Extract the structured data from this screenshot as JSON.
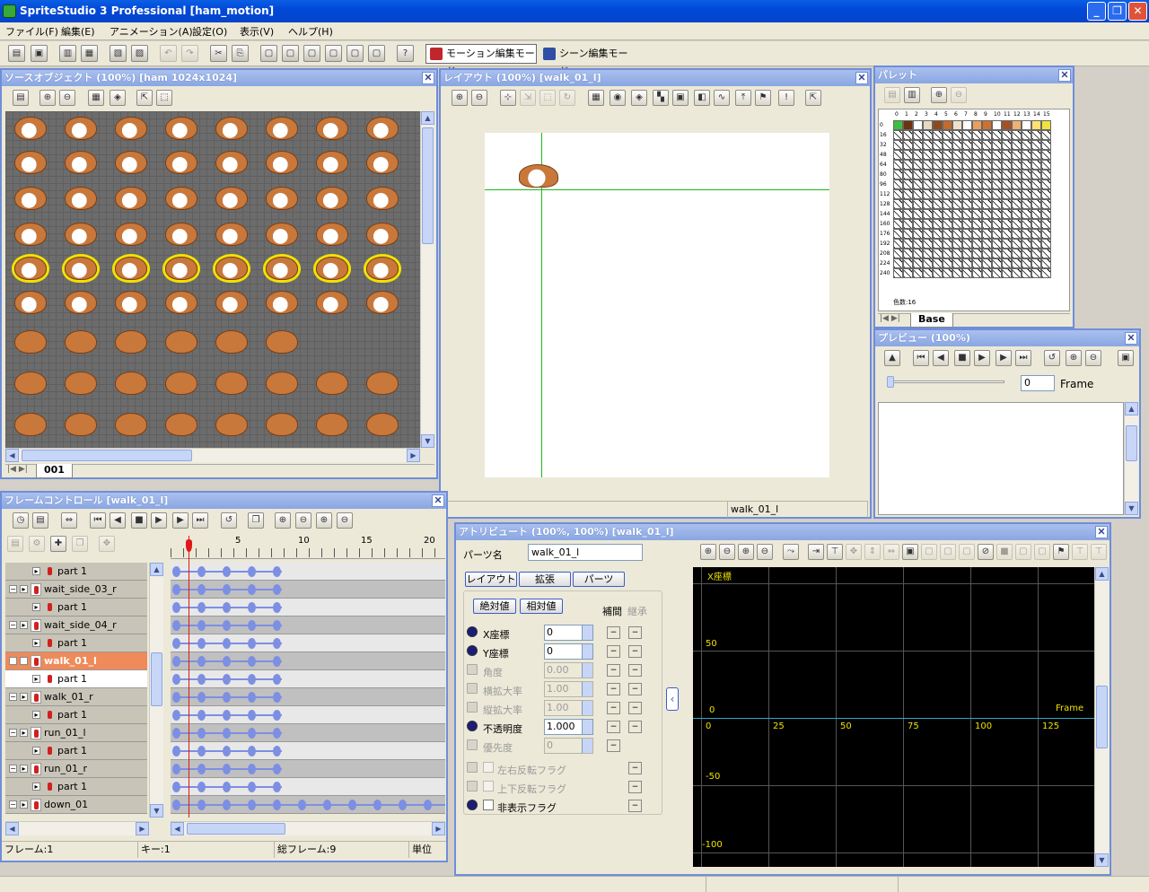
{
  "window": {
    "title": "SpriteStudio 3 Professional [ham_motion]"
  },
  "menu": [
    "ファイル(F)",
    "編集(E)",
    "アニメーション(A)",
    "設定(O)",
    "表示(V)",
    "ヘルプ(H)"
  ],
  "toolbar": {
    "motion_mode": "モーション編集モード",
    "scene_mode": "シーン編集モード"
  },
  "source": {
    "title": "ソースオブジェクト (100%) [ham  1024x1024]",
    "tab": "001"
  },
  "layout": {
    "title": "レイアウト (100%) [walk_01_l]",
    "status": "walk_01_l"
  },
  "palette": {
    "title": "パレット",
    "columns": [
      "0",
      "1",
      "2",
      "3",
      "4",
      "5",
      "6",
      "7",
      "8",
      "9",
      "10",
      "11",
      "12",
      "13",
      "14",
      "15"
    ],
    "rows": [
      "0",
      "16",
      "32",
      "48",
      "64",
      "80",
      "96",
      "112",
      "128",
      "144",
      "160",
      "176",
      "192",
      "208",
      "224",
      "240"
    ],
    "first_row_colors": [
      "#3fbf3f",
      "#6b3510",
      "#fff",
      "#e8d8c0",
      "#8c4a1c",
      "#c46a2c",
      "#f0e0c8",
      "#ffffff",
      "#e8a060",
      "#d07030",
      "#ffffff",
      "#a85020",
      "#f0b070",
      "#ffffff",
      "#ffe070",
      "#f0e040"
    ],
    "color_count": "色数:16",
    "tab": "Base"
  },
  "preview": {
    "title": "プレビュー (100%)",
    "frame_value": "0",
    "frame_label": "Frame"
  },
  "frame_control": {
    "title": "フレームコントロール [walk_01_l]",
    "ruler": [
      "5",
      "10",
      "15",
      "20"
    ],
    "rows": [
      {
        "label": "part 1",
        "type": "part"
      },
      {
        "label": "wait_side_03_r",
        "type": "motion"
      },
      {
        "label": "part 1",
        "type": "part"
      },
      {
        "label": "wait_side_04_r",
        "type": "motion"
      },
      {
        "label": "part 1",
        "type": "part"
      },
      {
        "label": "walk_01_l",
        "type": "motion",
        "selected": true
      },
      {
        "label": "part 1",
        "type": "part",
        "active": true
      },
      {
        "label": "walk_01_r",
        "type": "motion"
      },
      {
        "label": "part 1",
        "type": "part"
      },
      {
        "label": "run_01_l",
        "type": "motion"
      },
      {
        "label": "part 1",
        "type": "part"
      },
      {
        "label": "run_01_r",
        "type": "motion"
      },
      {
        "label": "part 1",
        "type": "part"
      },
      {
        "label": "down_01",
        "type": "motion"
      }
    ],
    "status": {
      "frame": "フレーム:1",
      "key": "キー:1",
      "total": "総フレーム:9",
      "unit": "単位"
    }
  },
  "attribute": {
    "title": "アトリビュート (100%, 100%) [walk_01_l]",
    "part_name_label": "パーツ名",
    "part_name": "walk_01_l",
    "tabs": [
      "レイアウト",
      "拡張",
      "パーツ"
    ],
    "modes": [
      "絶対値",
      "相対値"
    ],
    "col_interp": "補間",
    "col_inherit": "継承",
    "fields": [
      {
        "label": "X座標",
        "value": "0",
        "enabled": true
      },
      {
        "label": "Y座標",
        "value": "0",
        "enabled": true
      },
      {
        "label": "角度",
        "value": "0.00",
        "enabled": false
      },
      {
        "label": "横拡大率",
        "value": "1.00",
        "enabled": false
      },
      {
        "label": "縦拡大率",
        "value": "1.00",
        "enabled": false
      },
      {
        "label": "不透明度",
        "value": "1.000",
        "enabled": true
      },
      {
        "label": "優先度",
        "value": "0",
        "enabled": false
      }
    ],
    "flags": [
      {
        "label": "左右反転フラグ",
        "enabled": false
      },
      {
        "label": "上下反転フラグ",
        "enabled": false
      },
      {
        "label": "非表示フラグ",
        "enabled": true
      }
    ],
    "graph": {
      "series_label": "X座標",
      "frame_label": "Frame",
      "y_ticks": [
        "50",
        "0",
        "-50",
        "-100"
      ],
      "x_ticks": [
        "0",
        "25",
        "50",
        "75",
        "100",
        "125"
      ]
    }
  }
}
